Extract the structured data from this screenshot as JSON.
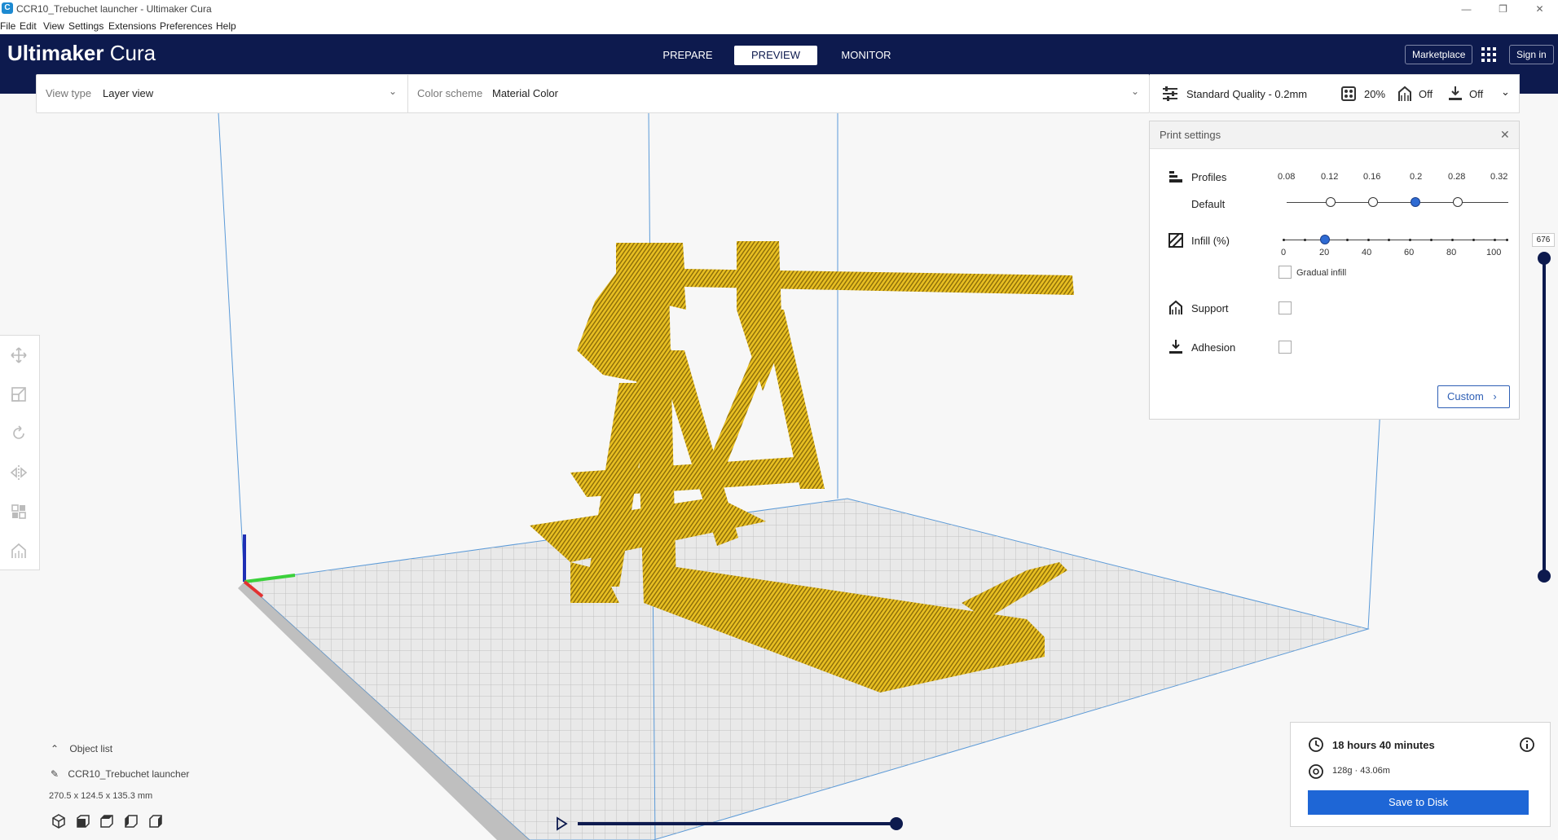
{
  "window": {
    "title": "CCR10_Trebuchet launcher - Ultimaker Cura",
    "minimize_glyph": "—",
    "maximize_glyph": "❐",
    "close_glyph": "✕"
  },
  "menu": {
    "items": [
      "File",
      "Edit",
      "View",
      "Settings",
      "Extensions",
      "Preferences",
      "Help"
    ]
  },
  "header": {
    "brand_bold": "Ultimaker",
    "brand_light": "Cura",
    "stages": [
      "PREPARE",
      "PREVIEW",
      "MONITOR"
    ],
    "active_stage": "PREVIEW",
    "marketplace_label": "Marketplace",
    "signin_label": "Sign in"
  },
  "view_controls": {
    "view_type_label": "View type",
    "view_type_value": "Layer view",
    "color_scheme_label": "Color scheme",
    "color_scheme_value": "Material Color"
  },
  "print_bar": {
    "quality": "Standard Quality - 0.2mm",
    "infill": "20%",
    "support": "Off",
    "adhesion": "Off"
  },
  "print_settings": {
    "title": "Print settings",
    "profiles_label": "Profiles",
    "profile_name": "Default",
    "layer_heights": [
      "0.08",
      "0.12",
      "0.16",
      "0.2",
      "0.28",
      "0.32"
    ],
    "selected_layer_height": "0.2",
    "infill_label": "Infill (%)",
    "infill_ticks": [
      "0",
      "20",
      "40",
      "60",
      "80",
      "100"
    ],
    "infill_value_percent": 20,
    "gradual_infill_label": "Gradual infill",
    "gradual_infill_checked": false,
    "support_label": "Support",
    "support_checked": false,
    "adhesion_label": "Adhesion",
    "adhesion_checked": false,
    "custom_label": "Custom"
  },
  "layer_slider": {
    "current_layer": "676"
  },
  "object_list": {
    "header": "Object list",
    "object_name": "CCR10_Trebuchet launcher",
    "dimensions": "270.5 x 124.5 x 135.3 mm"
  },
  "estimate": {
    "time": "18 hours 40 minutes",
    "material": "128g · 43.06m",
    "save_label": "Save to Disk"
  },
  "colors": {
    "header_bg": "#0d1a4e",
    "accent_blue": "#1e66d6",
    "model_yellow": "#e8bf22"
  }
}
